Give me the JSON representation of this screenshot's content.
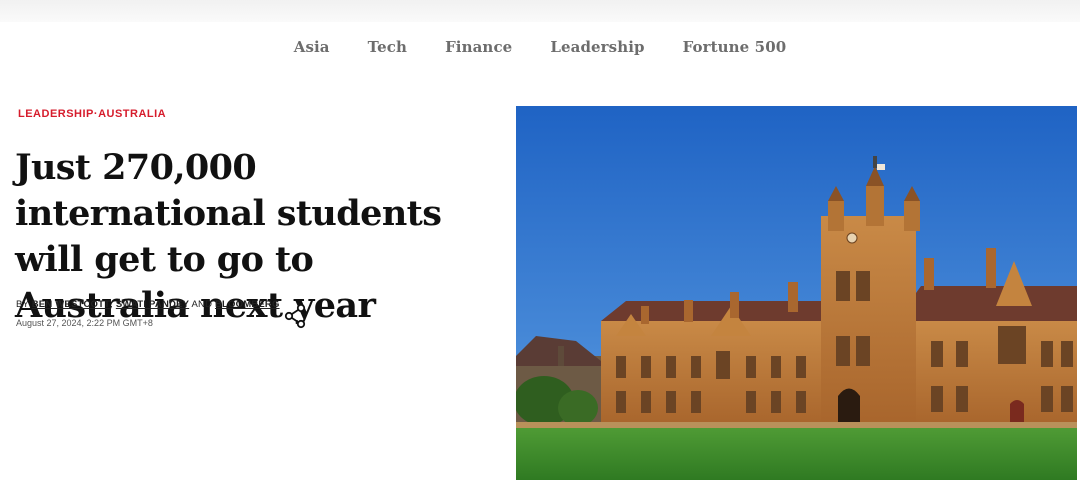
{
  "nav": {
    "items": [
      "Asia",
      "Tech",
      "Finance",
      "Leadership",
      "Fortune 500"
    ]
  },
  "article": {
    "kicker_section": "LEADERSHIP",
    "kicker_separator": "·",
    "kicker_topic": "AUSTRALIA",
    "headline": "Just 270,000 international students will get to go to Australia next year",
    "byline_prefix": "BY",
    "authors": [
      "BEN WESTCOTT",
      "SWATI PANDEY",
      "BLOOMBERG"
    ],
    "author_separator": ", ",
    "author_and": " AND ",
    "date": "August 27, 2024, 2:22 PM GMT+8",
    "share_icon": "share-icon",
    "image_subject": "university-building-photo"
  },
  "colors": {
    "kicker": "#d61c2c",
    "nav_text": "#6d6d6d",
    "headline": "#111111",
    "sky": "#2a6fc9",
    "sandstone": "#b9783a",
    "lawn": "#3f8a2a"
  }
}
